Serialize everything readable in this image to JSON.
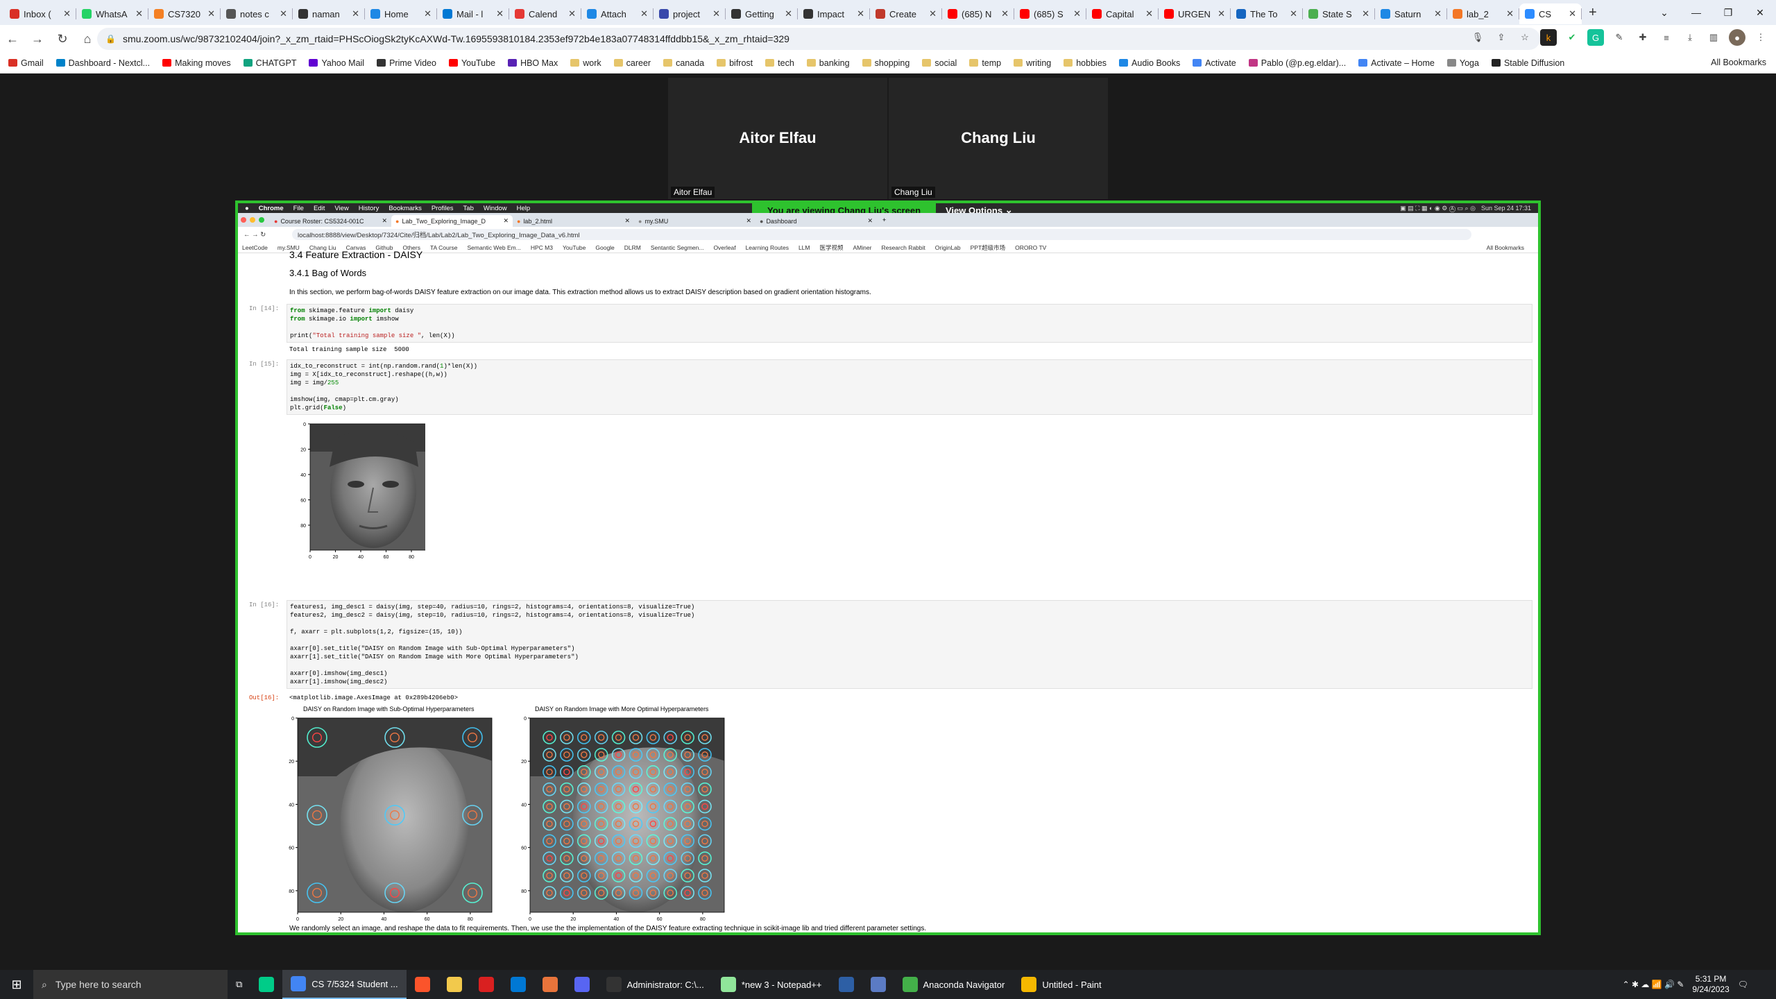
{
  "browser": {
    "tabs": [
      {
        "label": "Inbox (",
        "color": "#d93025",
        "icon": "gmail-icon"
      },
      {
        "label": "WhatsA",
        "color": "#25d366",
        "icon": "whatsapp-icon"
      },
      {
        "label": "CS7320",
        "color": "#f48024",
        "icon": "canvas-icon"
      },
      {
        "label": "notes c",
        "color": "#555",
        "icon": "notes-icon"
      },
      {
        "label": "naman",
        "color": "#333",
        "icon": "github-icon"
      },
      {
        "label": "Home",
        "color": "#1e88e5",
        "icon": "home-icon"
      },
      {
        "label": "Mail - l",
        "color": "#0078d4",
        "icon": "outlook-icon"
      },
      {
        "label": "Calend",
        "color": "#e53935",
        "icon": "calendar-icon"
      },
      {
        "label": "Attach",
        "color": "#1e88e5",
        "icon": "cloud-icon"
      },
      {
        "label": "project",
        "color": "#3949ab",
        "icon": "doc-icon"
      },
      {
        "label": "Getting",
        "color": "#333",
        "icon": "github-icon"
      },
      {
        "label": "Impact",
        "color": "#333",
        "icon": "github-icon"
      },
      {
        "label": "Create",
        "color": "#c0392b",
        "icon": "slides-icon"
      },
      {
        "label": "(685) N",
        "color": "#ff0000",
        "icon": "youtube-icon"
      },
      {
        "label": "(685) S",
        "color": "#ff0000",
        "icon": "youtube-icon"
      },
      {
        "label": "Capital",
        "color": "#ff0000",
        "icon": "youtube-icon"
      },
      {
        "label": "URGEN",
        "color": "#ff0000",
        "icon": "youtube-icon"
      },
      {
        "label": "The To",
        "color": "#1565c0",
        "icon": "v-icon"
      },
      {
        "label": "State S",
        "color": "#4caf50",
        "icon": "sheet-icon"
      },
      {
        "label": "Saturn",
        "color": "#1e88e5",
        "icon": "search-icon"
      },
      {
        "label": "lab_2",
        "color": "#f37726",
        "icon": "jupyter-icon"
      },
      {
        "label": "CS",
        "color": "#2d8cff",
        "icon": "zoom-icon"
      }
    ],
    "new_tab": "+",
    "url": "smu.zoom.us/wc/98732102404/join?_x_zm_rtaid=PHScOiogSk2tyKcAXWd-Tw.1695593810184.2353ef972b4e183a07748314ffddbb15&_x_zm_rhtaid=329",
    "bookmarks": [
      {
        "label": "Gmail",
        "type": "site",
        "color": "#d93025"
      },
      {
        "label": "Dashboard - Nextcl...",
        "type": "site",
        "color": "#0082c9"
      },
      {
        "label": "Making moves",
        "type": "site",
        "color": "#ff0000"
      },
      {
        "label": "CHATGPT",
        "type": "site",
        "color": "#10a37f"
      },
      {
        "label": "Yahoo Mail",
        "type": "site",
        "color": "#6001d2"
      },
      {
        "label": "Prime Video",
        "type": "site",
        "color": "#333"
      },
      {
        "label": "YouTube",
        "type": "site",
        "color": "#ff0000"
      },
      {
        "label": "HBO Max",
        "type": "site",
        "color": "#5822b4"
      },
      {
        "label": "work",
        "type": "folder"
      },
      {
        "label": "career",
        "type": "folder"
      },
      {
        "label": "canada",
        "type": "folder"
      },
      {
        "label": "bifrost",
        "type": "folder"
      },
      {
        "label": "tech",
        "type": "folder"
      },
      {
        "label": "banking",
        "type": "folder"
      },
      {
        "label": "shopping",
        "type": "folder"
      },
      {
        "label": "social",
        "type": "folder"
      },
      {
        "label": "temp",
        "type": "folder"
      },
      {
        "label": "writing",
        "type": "folder"
      },
      {
        "label": "hobbies",
        "type": "folder"
      },
      {
        "label": "Audio Books",
        "type": "site",
        "color": "#1e88e5"
      },
      {
        "label": "Activate",
        "type": "site",
        "color": "#4285f4"
      },
      {
        "label": "Pablo (@p.eg.eldar)...",
        "type": "site",
        "color": "#c13584"
      },
      {
        "label": "Activate – Home",
        "type": "site",
        "color": "#4285f4"
      },
      {
        "label": "Yoga",
        "type": "site",
        "color": "#888"
      },
      {
        "label": "Stable Diffusion",
        "type": "site",
        "color": "#222"
      }
    ],
    "all_bookmarks": "All Bookmarks"
  },
  "zoom": {
    "participants": [
      {
        "name": "Aitor Elfau",
        "label": "Aitor Elfau"
      },
      {
        "name": "Chang Liu",
        "label": "Chang Liu"
      }
    ],
    "viewing_banner": "You are viewing  Chang Liu's screen",
    "view_options": "View Options"
  },
  "remote": {
    "mac_menu": [
      "Chrome",
      "File",
      "Edit",
      "View",
      "History",
      "Bookmarks",
      "Profiles",
      "Tab",
      "Window",
      "Help"
    ],
    "mac_clock": "Sun Sep 24  17:31",
    "tabs": [
      "Course Roster: CS5324-001C",
      "Lab_Two_Exploring_Image_D",
      "lab_2.html",
      "my.SMU",
      "Dashboard"
    ],
    "url": "localhost:8888/view/Desktop/7324/Cite/归档/Lab/Lab2/Lab_Two_Exploring_Image_Data_v6.html",
    "bookmarks": [
      "LeetCode",
      "my.SMU",
      "Chang Liu",
      "Canvas",
      "Github",
      "Others",
      "TA Course",
      "Semantic Web Em...",
      "HPC M3",
      "YouTube",
      "Google",
      "DLRM",
      "Sentantic Segmen...",
      "Overleaf",
      "Learning Routes",
      "LLM",
      "医学视频",
      "AMiner",
      "Research Rabbit",
      "OriginLab",
      "PPT超级市场",
      "ORORO TV"
    ],
    "all_bookmarks": "All Bookmarks"
  },
  "notebook": {
    "h3": "3.4 Feature Extraction - DAISY",
    "h4": "3.4.1 Bag of Words",
    "para": "In this section, we perform bag-of-words DAISY feature extraction on our image data. This extraction method allows us to extract DAISY description based on gradient orientation histograms.",
    "prompt14": "In [14]:",
    "cell14": [
      "from skimage.feature import daisy",
      "from skimage.io import imshow",
      "",
      "print(\"Total training sample size \", len(X))"
    ],
    "out14": "Total training sample size  5000",
    "prompt15": "In [15]:",
    "cell15": [
      "idx_to_reconstruct = int(np.random.rand(1)*len(X))",
      "img = X[idx_to_reconstruct].reshape((h,w))",
      "img = img/255",
      "",
      "imshow(img, cmap=plt.cm.gray)",
      "plt.grid(False)"
    ],
    "face_ticks_y": [
      "0",
      "20",
      "40",
      "60",
      "80"
    ],
    "face_ticks_x": [
      "0",
      "20",
      "40",
      "60",
      "80"
    ],
    "prompt16": "In [16]:",
    "cell16": [
      "features1, img_desc1 = daisy(img, step=40, radius=10, rings=2, histograms=4, orientations=8, visualize=True)",
      "features2, img_desc2 = daisy(img, step=10, radius=10, rings=2, histograms=4, orientations=8, visualize=True)",
      "",
      "f, axarr = plt.subplots(1,2, figsize=(15, 10))",
      "",
      "axarr[0].set_title(\"DAISY on Random Image with Sub-Optimal Hyperparameters\")",
      "axarr[1].set_title(\"DAISY on Random Image with More Optimal Hyperparameters\")",
      "",
      "axarr[0].imshow(img_desc1)",
      "axarr[1].imshow(img_desc2)"
    ],
    "out_prompt16": "Out[16]:",
    "out16": "<matplotlib.image.AxesImage at 0x289b4206eb0>",
    "title_left": "DAISY on Random Image with Sub-Optimal Hyperparameters",
    "title_right": "DAISY on Random Image with More Optimal Hyperparameters",
    "bottom_text": "We randomly select an image, and reshape the data to fit requirements. Then, we use the the implementation of the DAISY feature extracting technique in  scikit-image  lib and tried different parameter settings."
  },
  "taskbar": {
    "search_placeholder": "Type here to search",
    "items": [
      {
        "label": "CS 7/5324 Student ...",
        "active": true,
        "color": "#4285f4"
      },
      {
        "label": "",
        "color": "#fb542b"
      },
      {
        "label": "",
        "color": "#f2c94c"
      },
      {
        "label": "",
        "color": "#d92020"
      },
      {
        "label": "",
        "color": "#0078d4"
      },
      {
        "label": "",
        "color": "#e8743b"
      },
      {
        "label": "",
        "color": "#5865f2"
      },
      {
        "label": "Administrator: C:\\...",
        "color": "#333"
      },
      {
        "label": "*new 3 - Notepad++",
        "color": "#90e59a"
      },
      {
        "label": "",
        "color": "#2d5fa5"
      },
      {
        "label": "",
        "color": "#5b7bc4"
      },
      {
        "label": "Anaconda Navigator",
        "color": "#43b049"
      },
      {
        "label": "Untitled - Paint",
        "color": "#f5b800"
      }
    ],
    "time": "5:31 PM",
    "date": "9/24/2023"
  }
}
